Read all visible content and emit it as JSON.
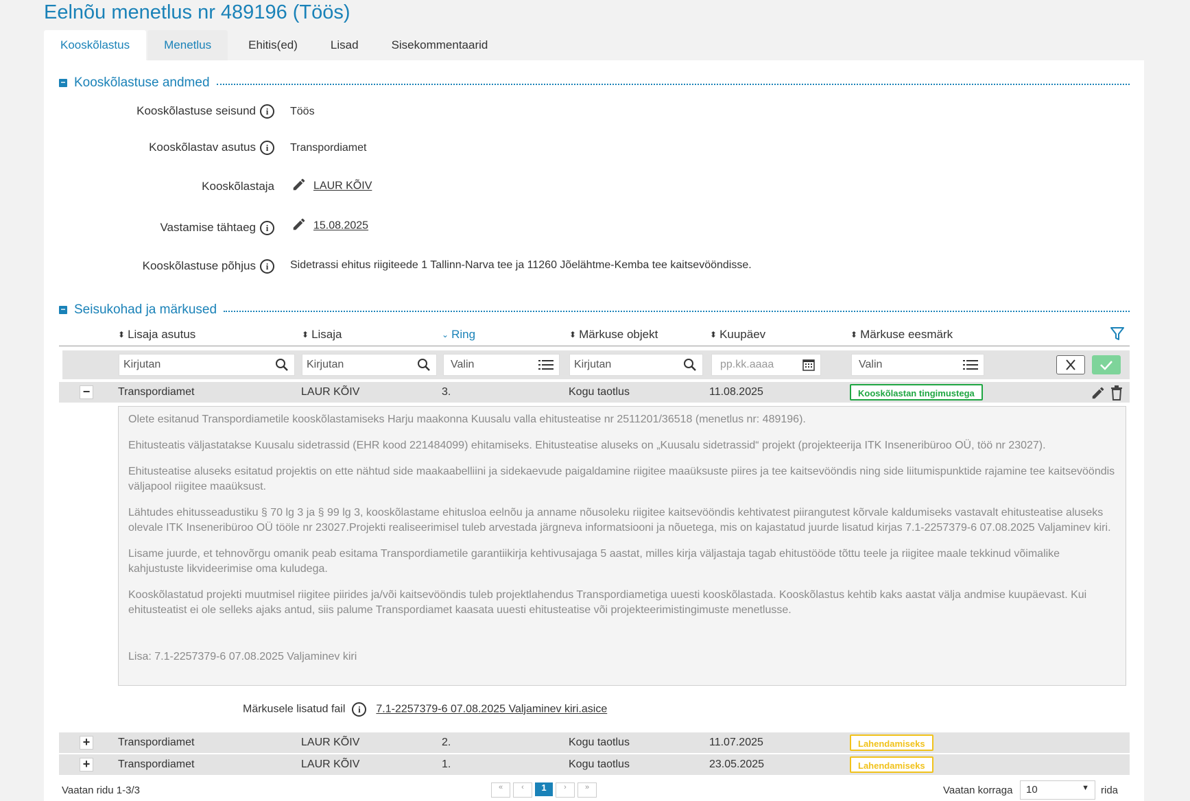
{
  "page_title": "Eelnõu menetlus nr 489196 (Töös)",
  "tabs": [
    {
      "label": "Kooskõlastus"
    },
    {
      "label": "Menetlus"
    },
    {
      "label": "Ehitis(ed)"
    },
    {
      "label": "Lisad"
    },
    {
      "label": "Sisekommentaarid"
    }
  ],
  "section1": {
    "title": "Kooskõlastuse andmed",
    "fields": [
      {
        "label": "Kooskõlastuse seisund",
        "value": "Töös"
      },
      {
        "label": "Kooskõlastav asutus",
        "value": "Transpordiamet"
      },
      {
        "label": "Kooskõlastaja",
        "value": "LAUR KÕIV"
      },
      {
        "label": "Vastamise tähtaeg",
        "value": "15.08.2025"
      },
      {
        "label": "Kooskõlastuse põhjus",
        "value": "Sidetrassi ehitus riigiteede 1 Tallinn-Narva tee ja 11260 Jõelähtme-Kemba tee kaitsevööndisse."
      }
    ]
  },
  "section2": {
    "title": "Seisukohad ja märkused",
    "columns": [
      "Lisaja asutus",
      "Lisaja",
      "Ring",
      "Märkuse objekt",
      "Kuupäev",
      "Märkuse eesmärk"
    ],
    "filters": {
      "text_placeholder": "Kirjutan",
      "select_placeholder": "Valin",
      "date_placeholder": "pp.kk.aaaa"
    },
    "rows": [
      {
        "asutus": "Transpordiamet",
        "lisaja": "LAUR KÕIV",
        "ring": "3.",
        "objekt": "Kogu taotlus",
        "kuupaev": "11.08.2025",
        "eesmark": "Kooskõlastan tingimustega"
      },
      {
        "asutus": "Transpordiamet",
        "lisaja": "LAUR KÕIV",
        "ring": "2.",
        "objekt": "Kogu taotlus",
        "kuupaev": "11.07.2025",
        "eesmark": "Lahendamiseks"
      },
      {
        "asutus": "Transpordiamet",
        "lisaja": "LAUR KÕIV",
        "ring": "1.",
        "objekt": "Kogu taotlus",
        "kuupaev": "23.05.2025",
        "eesmark": "Lahendamiseks"
      }
    ],
    "detail_paragraphs": [
      "Olete esitanud Transpordiametile kooskõlastamiseks Harju maakonna Kuusalu valla ehitusteatise nr 2511201/36518 (menetlus nr: 489196).",
      "Ehitusteatis väljastatakse Kuusalu sidetrassid (EHR kood 221484099) ehitamiseks. Ehitusteatise aluseks on „Kuusalu sidetrassid“ projekt (projekteerija ITK Inseneribüroo OÜ, töö nr 23027).",
      "Ehitusteatise aluseks esitatud projektis on ette nähtud side maakaabelliini ja sidekaevude paigaldamine riigitee maaüksuste piires ja tee kaitsevööndis ning side liitumispunktide rajamine tee kaitsevööndis väljapool riigitee maaüksust.",
      "Lähtudes ehitusseadustiku § 70 lg 3 ja § 99 lg 3, kooskõlastame ehitusloa eelnõu ja anname nõusoleku riigitee kaitsevööndis kehtivatest piirangutest kõrvale kaldumiseks vastavalt ehitusteatise aluseks olevale ITK Inseneribüroo OÜ tööle nr 23027.Projekti realiseerimisel tuleb arvestada järgneva informatsiooni ja nõuetega, mis on kajastatud juurde lisatud kirjas 7.1-2257379-6 07.08.2025 Valjaminev kiri.",
      "Lisame juurde, et tehnovõrgu omanik peab esitama Transpordiametile garantiikirja kehtivusajaga 5 aastat, milles kirja väljastaja tagab ehitustööde tõttu teele ja riigitee maale tekkinud võimalike kahjustuste likvideerimise oma kuludega.",
      "Kooskõlastatud projekti muutmisel riigitee piirides ja/või kaitsevööndis tuleb projektlahendus Transpordiametiga uuesti kooskõlastada. Kooskõlastus kehtib kaks aastat välja andmise kuupäevast. Kui ehitusteatist ei ole selleks ajaks antud, siis palume Transpordiamet kaasata uuesti ehitusteatise või projekteerimistingimuste menetlusse."
    ],
    "detail_attachment": "Lisa: 7.1-2257379-6 07.08.2025 Valjaminev kiri",
    "file_label": "Märkusele lisatud fail",
    "file_link": "7.1-2257379-6 07.08.2025 Valjaminev kiri.asice"
  },
  "footer": {
    "rows_info": "Vaatan ridu 1-3/3",
    "current_page": "1",
    "per_page_label": "Vaatan korraga",
    "per_page_value": "10",
    "per_page_suffix": "rida"
  },
  "colors": {
    "accent": "#1a82b8",
    "green": "#1fa642",
    "yellow": "#f1c21b"
  }
}
